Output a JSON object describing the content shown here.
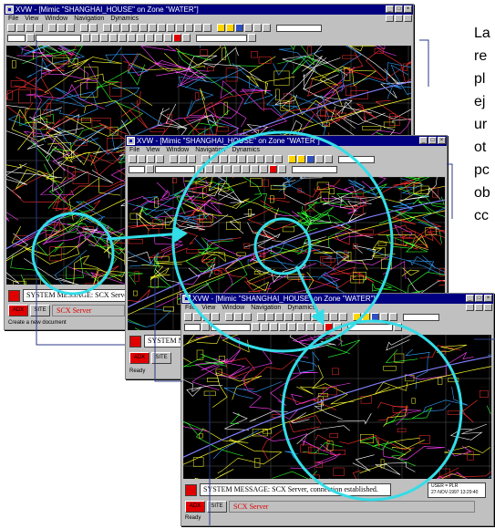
{
  "windows": [
    {
      "title": "XVW - [Mimic \"SHANGHAI_HOUSE\" on Zone \"WATER\"]",
      "menu": [
        "File",
        "View",
        "Window",
        "Navigation",
        "Dynamics"
      ],
      "system_message": "SYSTEM MESSAGE: SCX Server, conn",
      "adx_label": "ADX",
      "site_label": "SITE",
      "server_label": "SCX Server",
      "status_line": "Create a new document"
    },
    {
      "title": "XVW - [Mimic \"SHANGHAI_HOUSE\" on Zone \"WATER\"]",
      "menu": [
        "File",
        "View",
        "Window",
        "Navigation",
        "Dynamics"
      ],
      "system_message": "SYSTEM ME",
      "adx_label": "ADX",
      "site_label": "SITE",
      "status_line": "Ready"
    },
    {
      "title": "XVW - [Mimic \"SHANGHAI_HOUSE\" on Zone \"WATER\"]",
      "menu": [
        "File",
        "View",
        "Window",
        "Navigation",
        "Dynamics"
      ],
      "system_message": "SYSTEM MESSAGE: SCX Server, connection established.",
      "user_label": "USER = PLR",
      "timestamp": "27-NOV-1997 13:29:40",
      "adx_label": "ADX",
      "site_label": "SITE",
      "server_label": "SCX Server",
      "status_line": "Ready"
    }
  ],
  "side_text": [
    "La",
    "re",
    "pl",
    "ej",
    "ur",
    "ot",
    "pc",
    "ob",
    "cc"
  ],
  "colors": {
    "title_bar": "#000080",
    "chrome": "#c0c0c0",
    "map_background": "#000000",
    "zoom_circle": "#33dde8",
    "alarm_red": "#e00000"
  },
  "icons": [
    "window-minimize-icon",
    "window-maximize-icon",
    "window-close-icon",
    "zoom-in-icon",
    "zoom-out-icon",
    "pan-icon",
    "pointer-icon"
  ]
}
